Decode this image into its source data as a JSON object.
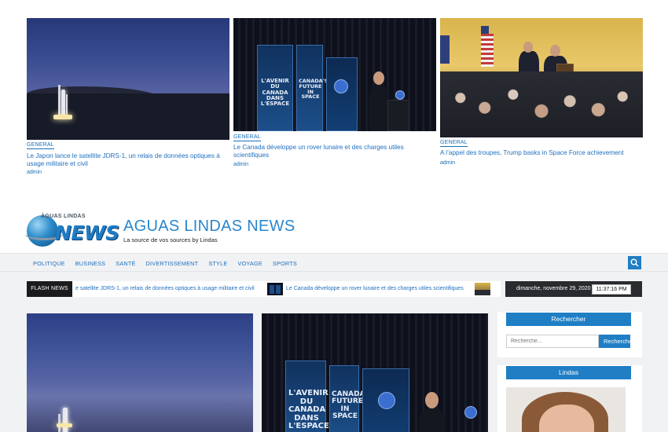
{
  "featured": [
    {
      "category": "GENERAL",
      "title": "Le Japon lance le satellite JDRS-1, un relais de données optiques à usage militaire et civil",
      "author": "admin"
    },
    {
      "category": "GENERAL",
      "title": "Le Canada développe un rover lunaire et des charges utiles scientifiques",
      "author": "admin"
    },
    {
      "category": "GENERAL",
      "title": "A l’appel des troupes, Trump basks in Space Force achievement",
      "author": "admin"
    }
  ],
  "banners": {
    "fr": "L'AVENIR DU CANADA DANS L'ESPACE",
    "en": "CANADA'S FUTURE IN SPACE"
  },
  "logo": {
    "top_text": "ÁGUAS LINDAS",
    "main_text": "NEWS"
  },
  "site": {
    "title": "AGUAS LINDAS NEWS",
    "tagline": "La source de vos sources by Lindas"
  },
  "nav": {
    "items": [
      "POLITIQUE",
      "BUSINESS",
      "SANTÉ",
      "DIVERTISSEMENT",
      "STYLE",
      "VOYAGE",
      "SPORTS"
    ],
    "search_icon": "search-icon"
  },
  "flash": {
    "label": "FLASH NEWS",
    "items": [
      "e satellite JDRS-1, un relais de données optiques à usage militaire et civil",
      "Le Canada développe un rover lunaire et des charges utiles scientifiques"
    ],
    "date": "dimanche, novembre 29, 2020",
    "time": "11:37:16 PM"
  },
  "sidebar": {
    "search_title": "Rechercher",
    "search_placeholder": "Recherche...",
    "search_button": "Rechercher",
    "lindas_title": "Lindas"
  },
  "colors": {
    "accent": "#1f7ec4",
    "link": "#1f6fbf",
    "dark": "#1b1b1d"
  }
}
